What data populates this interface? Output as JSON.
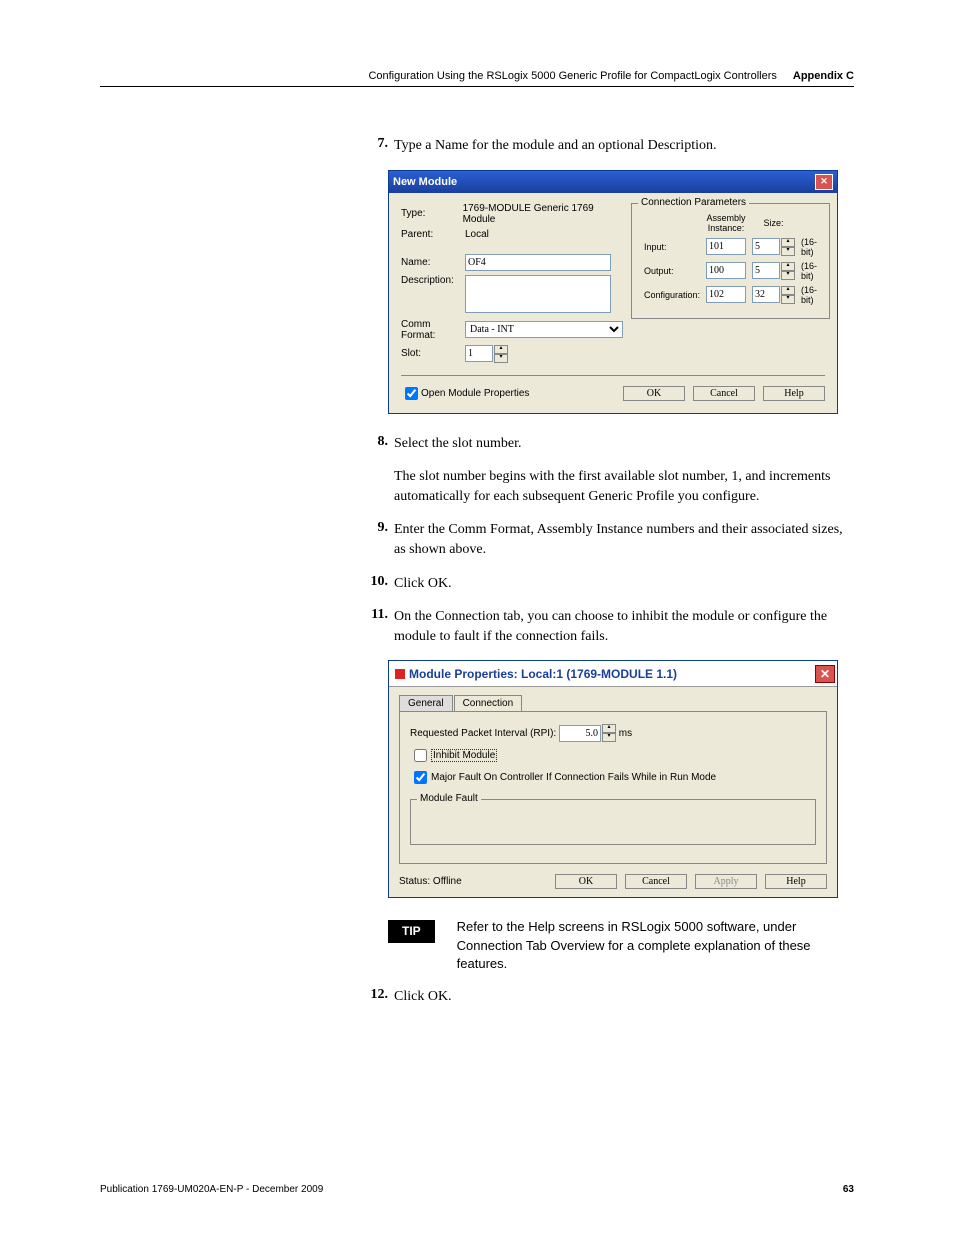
{
  "header": {
    "chapter": "Configuration Using the RSLogix 5000 Generic Profile for CompactLogix Controllers",
    "appendix": "Appendix C"
  },
  "steps": {
    "s7": {
      "num": "7.",
      "text": "Type a Name for the module and an optional Description."
    },
    "s8": {
      "num": "8.",
      "text": "Select the slot number.",
      "para": "The slot number begins with the first available slot number, 1, and increments automatically for each subsequent Generic Profile you configure."
    },
    "s9": {
      "num": "9.",
      "text": "Enter the Comm Format, Assembly Instance numbers and their associated sizes, as shown above."
    },
    "s10": {
      "num": "10.",
      "text": "Click OK."
    },
    "s11": {
      "num": "11.",
      "text": "On the Connection tab, you can choose to inhibit the module or configure the module to fault if the connection fails."
    },
    "s12": {
      "num": "12.",
      "text": "Click OK."
    }
  },
  "newModule": {
    "title": "New Module",
    "labels": {
      "type": "Type:",
      "parent": "Parent:",
      "name": "Name:",
      "description": "Description:",
      "comm": "Comm Format:",
      "slot": "Slot:"
    },
    "values": {
      "type": "1769-MODULE Generic 1769 Module",
      "parent": "Local",
      "name": "OF4",
      "description": "",
      "comm": "Data - INT",
      "slot": "1"
    },
    "conn": {
      "legend": "Connection Parameters",
      "assembly_hdr": "Assembly\nInstance:",
      "size_hdr": "Size:",
      "rows": {
        "input": {
          "lbl": "Input:",
          "inst": "101",
          "size": "5",
          "unit": "(16-bit)"
        },
        "output": {
          "lbl": "Output:",
          "inst": "100",
          "size": "5",
          "unit": "(16-bit)"
        },
        "config": {
          "lbl": "Configuration:",
          "inst": "102",
          "size": "32",
          "unit": "(16-bit)"
        }
      }
    },
    "openModule": "Open Module Properties",
    "buttons": {
      "ok": "OK",
      "cancel": "Cancel",
      "help": "Help"
    }
  },
  "modProps": {
    "title": "Module Properties: Local:1 (1769-MODULE 1.1)",
    "tabs": {
      "general": "General",
      "connection": "Connection"
    },
    "rpi_lbl": "Requested Packet Interval (RPI):",
    "rpi_val": "5.0",
    "rpi_unit": "ms",
    "inhibit": "Inhibit Module",
    "majorFault": "Major Fault On Controller If Connection Fails While in Run Mode",
    "faultGroup": "Module Fault",
    "status_lbl": "Status:",
    "status_val": "Offline",
    "buttons": {
      "ok": "OK",
      "cancel": "Cancel",
      "apply": "Apply",
      "help": "Help"
    }
  },
  "tip": {
    "badge": "TIP",
    "text": "Refer to the Help screens in RSLogix 5000 software, under Connection Tab Overview for a complete explanation of these features."
  },
  "footer": {
    "pub": "Publication 1769-UM020A-EN-P - December 2009",
    "page": "63"
  }
}
